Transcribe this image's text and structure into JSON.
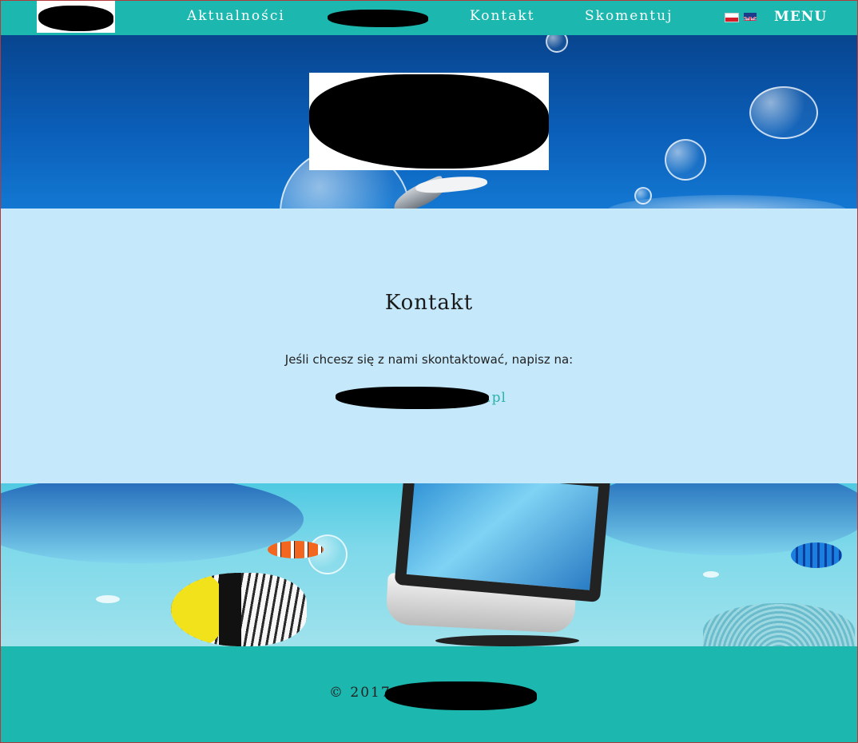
{
  "nav": {
    "items": [
      {
        "label": "Aktualności"
      },
      {
        "label": "Kontakt"
      },
      {
        "label": "Skomentuj"
      }
    ],
    "languages": [
      "pl",
      "en"
    ],
    "menu_label": "MENU"
  },
  "contact": {
    "title": "Kontakt",
    "text": "Jeśli chcesz się z nami skontaktować, napisz na:",
    "email_visible_suffix": ".pl"
  },
  "footer": {
    "copyright": "© 2017"
  },
  "colors": {
    "nav_bg": "#1cb7ae",
    "contact_bg": "#c5e8fa",
    "link": "#2bb3aa",
    "footer_bg": "#1cb7ae"
  }
}
